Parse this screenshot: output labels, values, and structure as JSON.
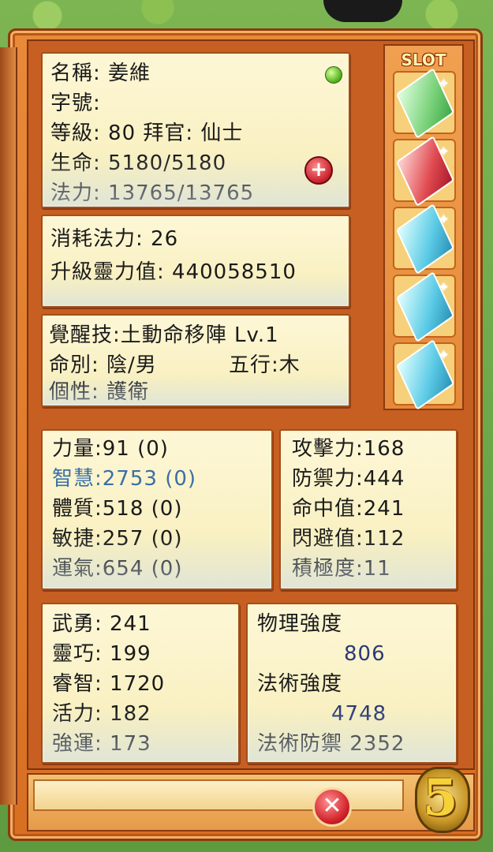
{
  "profile": {
    "name": "名稱:  姜維",
    "title": "字號:",
    "level": "等級: 80   拜官:  仙士",
    "hp": "生命:  5180/5180",
    "mp": "法力:  13765/13765"
  },
  "cost": {
    "mp_cost": "消耗法力: 26",
    "upgrade_spirit": "升級靈力值:  440058510"
  },
  "awaken": {
    "skill": "覺醒技:土動命移陣 Lv.1",
    "gender": "命別:  陰/男",
    "element": "五行:木",
    "personality": "個性:  護衛"
  },
  "slot": {
    "label": "SLOT",
    "items": [
      {
        "icon": "green-scroll-card-icon"
      },
      {
        "icon": "red-scroll-card-icon"
      },
      {
        "icon": "cyan-scroll-card-icon"
      },
      {
        "icon": "cyan-scroll-card-icon"
      },
      {
        "icon": "cyan-scroll-card-icon"
      }
    ]
  },
  "attributes": [
    {
      "label": "力量:91 (0)"
    },
    {
      "label": "智慧:2753 (0)",
      "color": "#3a6fa6"
    },
    {
      "label": "體質:518 (0)"
    },
    {
      "label": "敏捷:257 (0)"
    },
    {
      "label": "運氣:654 (0)"
    }
  ],
  "combat": [
    {
      "label": "攻擊力:168"
    },
    {
      "label": "防禦力:444"
    },
    {
      "label": "命中值:241"
    },
    {
      "label": "閃避值:112"
    },
    {
      "label": "積極度:11"
    }
  ],
  "traits": [
    {
      "label": "武勇:  241"
    },
    {
      "label": "靈巧:  199"
    },
    {
      "label": "睿智:  1720"
    },
    {
      "label": "活力:  182"
    },
    {
      "label": "強運:  173"
    }
  ],
  "strength": {
    "physical_label": "物理強度",
    "physical_value": "806",
    "magic_label": "法術強度",
    "magic_value": "4748",
    "magic_defense": "法術防禦 2352"
  },
  "colors": {
    "frame": "#d86f22",
    "panel": "#fdf7d6",
    "highlight_blue": "#3a6fa6",
    "value_navy": "#2a3a78"
  }
}
